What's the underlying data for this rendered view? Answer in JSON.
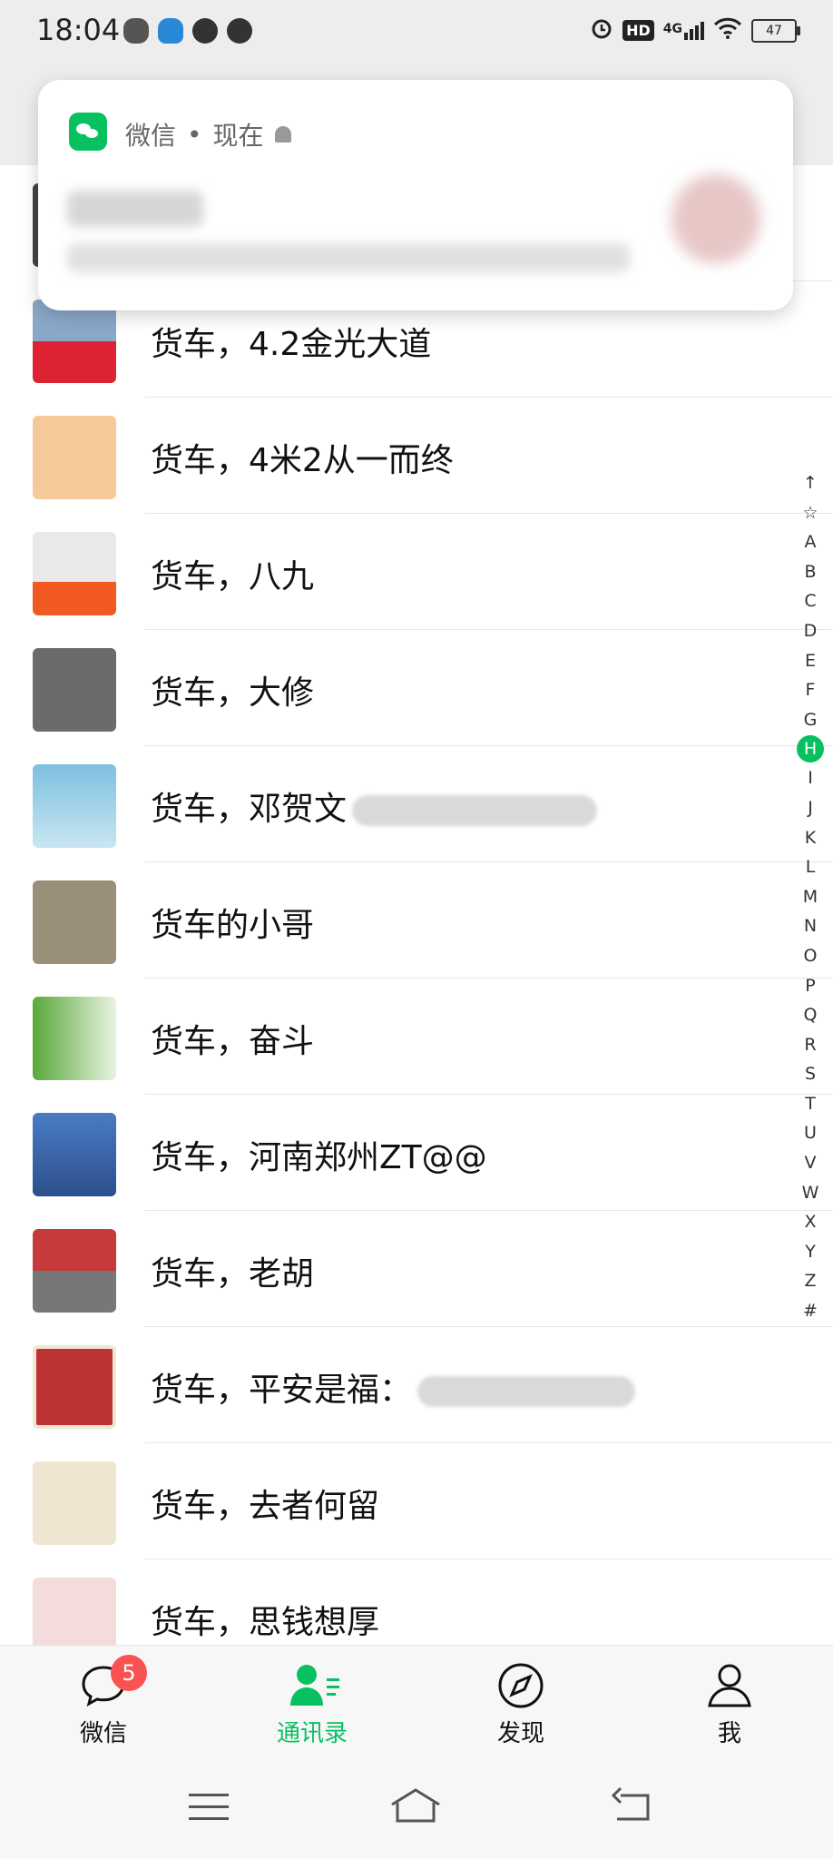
{
  "status": {
    "time": "18:04",
    "network": "4G",
    "hd": "HD",
    "battery": "47"
  },
  "notification": {
    "app": "微信",
    "time": "现在"
  },
  "contacts": [
    {
      "name": "货车，4.2金光大道"
    },
    {
      "name": "货车，4米2从一而终"
    },
    {
      "name": "货车，八九"
    },
    {
      "name": "货车，大修"
    },
    {
      "name": "货车，邓贺文"
    },
    {
      "name": "货车的小哥"
    },
    {
      "name": "货车，奋斗"
    },
    {
      "name": "货车，河南郑州ZT@@"
    },
    {
      "name": "货车，老胡"
    },
    {
      "name": "货车，平安是福："
    },
    {
      "name": "货车，去者何留"
    },
    {
      "name": "货车，思钱想厚"
    }
  ],
  "index": {
    "items": [
      "↑",
      "☆",
      "A",
      "B",
      "C",
      "D",
      "E",
      "F",
      "G",
      "H",
      "I",
      "J",
      "K",
      "L",
      "M",
      "N",
      "O",
      "P",
      "Q",
      "R",
      "S",
      "T",
      "U",
      "V",
      "W",
      "X",
      "Y",
      "Z",
      "#"
    ],
    "active": "H"
  },
  "tabs": [
    {
      "label": "微信",
      "badge": "5"
    },
    {
      "label": "通讯录"
    },
    {
      "label": "发现"
    },
    {
      "label": "我"
    }
  ],
  "colors": {
    "accent": "#07c160",
    "badge": "#fa5151"
  }
}
